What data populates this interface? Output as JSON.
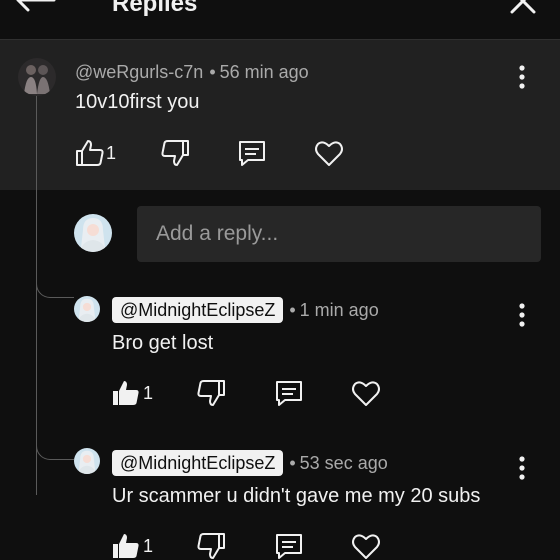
{
  "header": {
    "title": "Replies"
  },
  "parent_comment": {
    "username": "@weRgurls-c7n",
    "separator": "•",
    "time": "56 min ago",
    "text": "10v10first you",
    "like_count": "1"
  },
  "reply_box": {
    "placeholder": "Add a reply..."
  },
  "replies": [
    {
      "username": "@MidnightEclipseZ",
      "separator": "•",
      "time": "1 min ago",
      "text": "Bro get lost",
      "like_count": "1"
    },
    {
      "username": "@MidnightEclipseZ",
      "separator": "•",
      "time": "53 sec ago",
      "text": "Ur scammer u didn't gave me my 20 subs",
      "like_count": "1"
    }
  ],
  "icons": {
    "back": "arrow-left-icon",
    "close": "close-icon",
    "more": "more-vertical-icon",
    "like": "thumbs-up-icon",
    "dislike": "thumbs-down-icon",
    "reply": "comment-icon",
    "heart": "heart-icon"
  },
  "colors": {
    "background": "#0f0f0f",
    "highlight_background": "#212121",
    "input_background": "#272727",
    "text_primary": "#f1f1f1",
    "text_secondary": "#aaaaaa",
    "mention_chip": "#f1f1f1"
  }
}
